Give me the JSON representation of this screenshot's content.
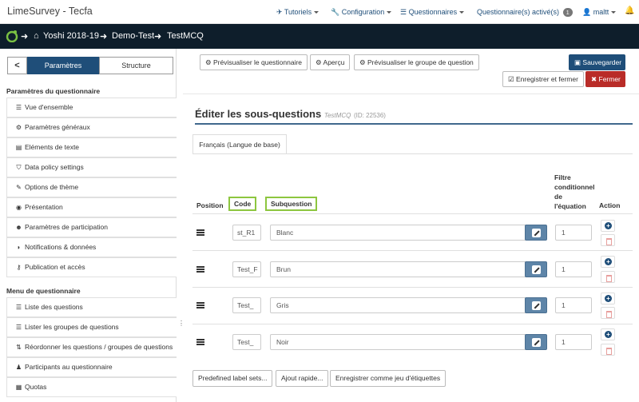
{
  "app": {
    "brand": "LimeSurvey - Tecfa"
  },
  "topnav": {
    "tutoriels": "Tutoriels",
    "configuration": "Configuration",
    "questionnaires": "Questionnaires",
    "active_label": "Questionnaire(s) activé(s)",
    "active_count": "1",
    "user": "maltt"
  },
  "breadcrumb": {
    "items": [
      "Yoshi 2018-19",
      "Demo-Test",
      "TestMCQ"
    ]
  },
  "sidebar": {
    "back": "<",
    "tab_params": "Paramètres",
    "tab_structure": "Structure",
    "section1": "Paramètres du questionnaire",
    "items1": [
      "Vue d'ensemble",
      "Paramètres généraux",
      "Eléments de texte",
      "Data policy settings",
      "Options de thème",
      "Présentation",
      "Paramètres de participation",
      "Notifications & données",
      "Publication et accès"
    ],
    "section2": "Menu de questionnaire",
    "items2": [
      "Liste des questions",
      "Lister les groupes de questions",
      "Réordonner les questions / groupes de questions",
      "Participants au questionnaire",
      "Quotas"
    ]
  },
  "toolbar": {
    "preview_survey": "Prévisualiser le questionnaire",
    "apercu": "Aperçu",
    "preview_group": "Prévisualiser le groupe de question",
    "save": "Sauvegarder",
    "save_close": "Enregistrer et fermer",
    "close": "Fermer"
  },
  "page": {
    "title": "Éditer les sous-questions",
    "survey_name": "TestMCQ",
    "survey_id": "(ID: 22536)",
    "lang_tab": "Français (Langue de base)"
  },
  "table": {
    "headers": {
      "position": "Position",
      "code": "Code",
      "subquestion": "Subquestion",
      "filter_lines": [
        "Filtre",
        "conditionnel",
        "de",
        "l'équation"
      ],
      "action": "Action"
    },
    "rows": [
      {
        "code": "st_R1",
        "subquestion": "Blanc",
        "filter": "1"
      },
      {
        "code": "Test_F",
        "subquestion": "Brun",
        "filter": "1"
      },
      {
        "code": "Test_",
        "subquestion": "Gris",
        "filter": "1"
      },
      {
        "code": "Test_",
        "subquestion": "Noir",
        "filter": "1"
      }
    ]
  },
  "bottom": {
    "label_sets": "Predefined label sets...",
    "quick_add": "Ajout rapide...",
    "save_labels": "Enregistrer comme jeu d'étiquettes"
  },
  "colors": {
    "brand_blue": "#1f4e79",
    "highlight_green": "#8dc63f",
    "danger": "#b92c28",
    "dark_bar": "#0e1e2b"
  }
}
